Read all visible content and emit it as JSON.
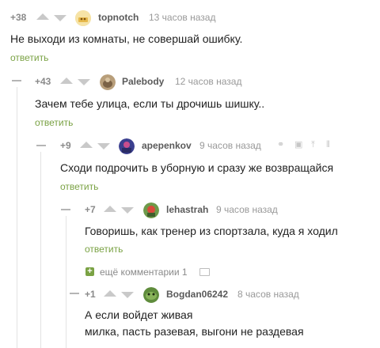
{
  "comments": [
    {
      "rating": "+38",
      "author": "topnotch",
      "time": "13 часов назад",
      "text": "Не выходи из комнаты, не совершай ошибку.",
      "reply": "ответить"
    },
    {
      "rating": "+43",
      "author": "Palebody",
      "time": "12 часов назад",
      "text": "Зачем тебе улица, если ты дрочишь шишку..",
      "reply": "ответить"
    },
    {
      "rating": "+9",
      "author": "apepenkov",
      "time": "9 часов назад",
      "text": "Сходи подрочить в уборную и сразу же возвращайся",
      "reply": "ответить"
    },
    {
      "rating": "+7",
      "author": "lehastrah",
      "time": "9 часов назад",
      "text": "Говоришь, как тренер из спортзала, куда я ходил",
      "reply": "ответить"
    },
    {
      "rating": "+1",
      "author": "Bogdan06242",
      "time": "8 часов назад",
      "text_lines": [
        "А если войдет живая",
        "милка, пасть разевая, выгони не раздевая"
      ]
    }
  ],
  "more_comments": {
    "icon": "+",
    "label": "ещё комментарии 1"
  },
  "icons": {
    "vote_up": "upvote-arrow-icon",
    "vote_down": "downvote-arrow-icon",
    "link": "link-icon",
    "save": "save-icon",
    "pin": "pin-icon",
    "collapse": "collapse-icon"
  },
  "colors": {
    "reply_link": "#7aa244",
    "vote_arrow": "#c9c9c9"
  }
}
